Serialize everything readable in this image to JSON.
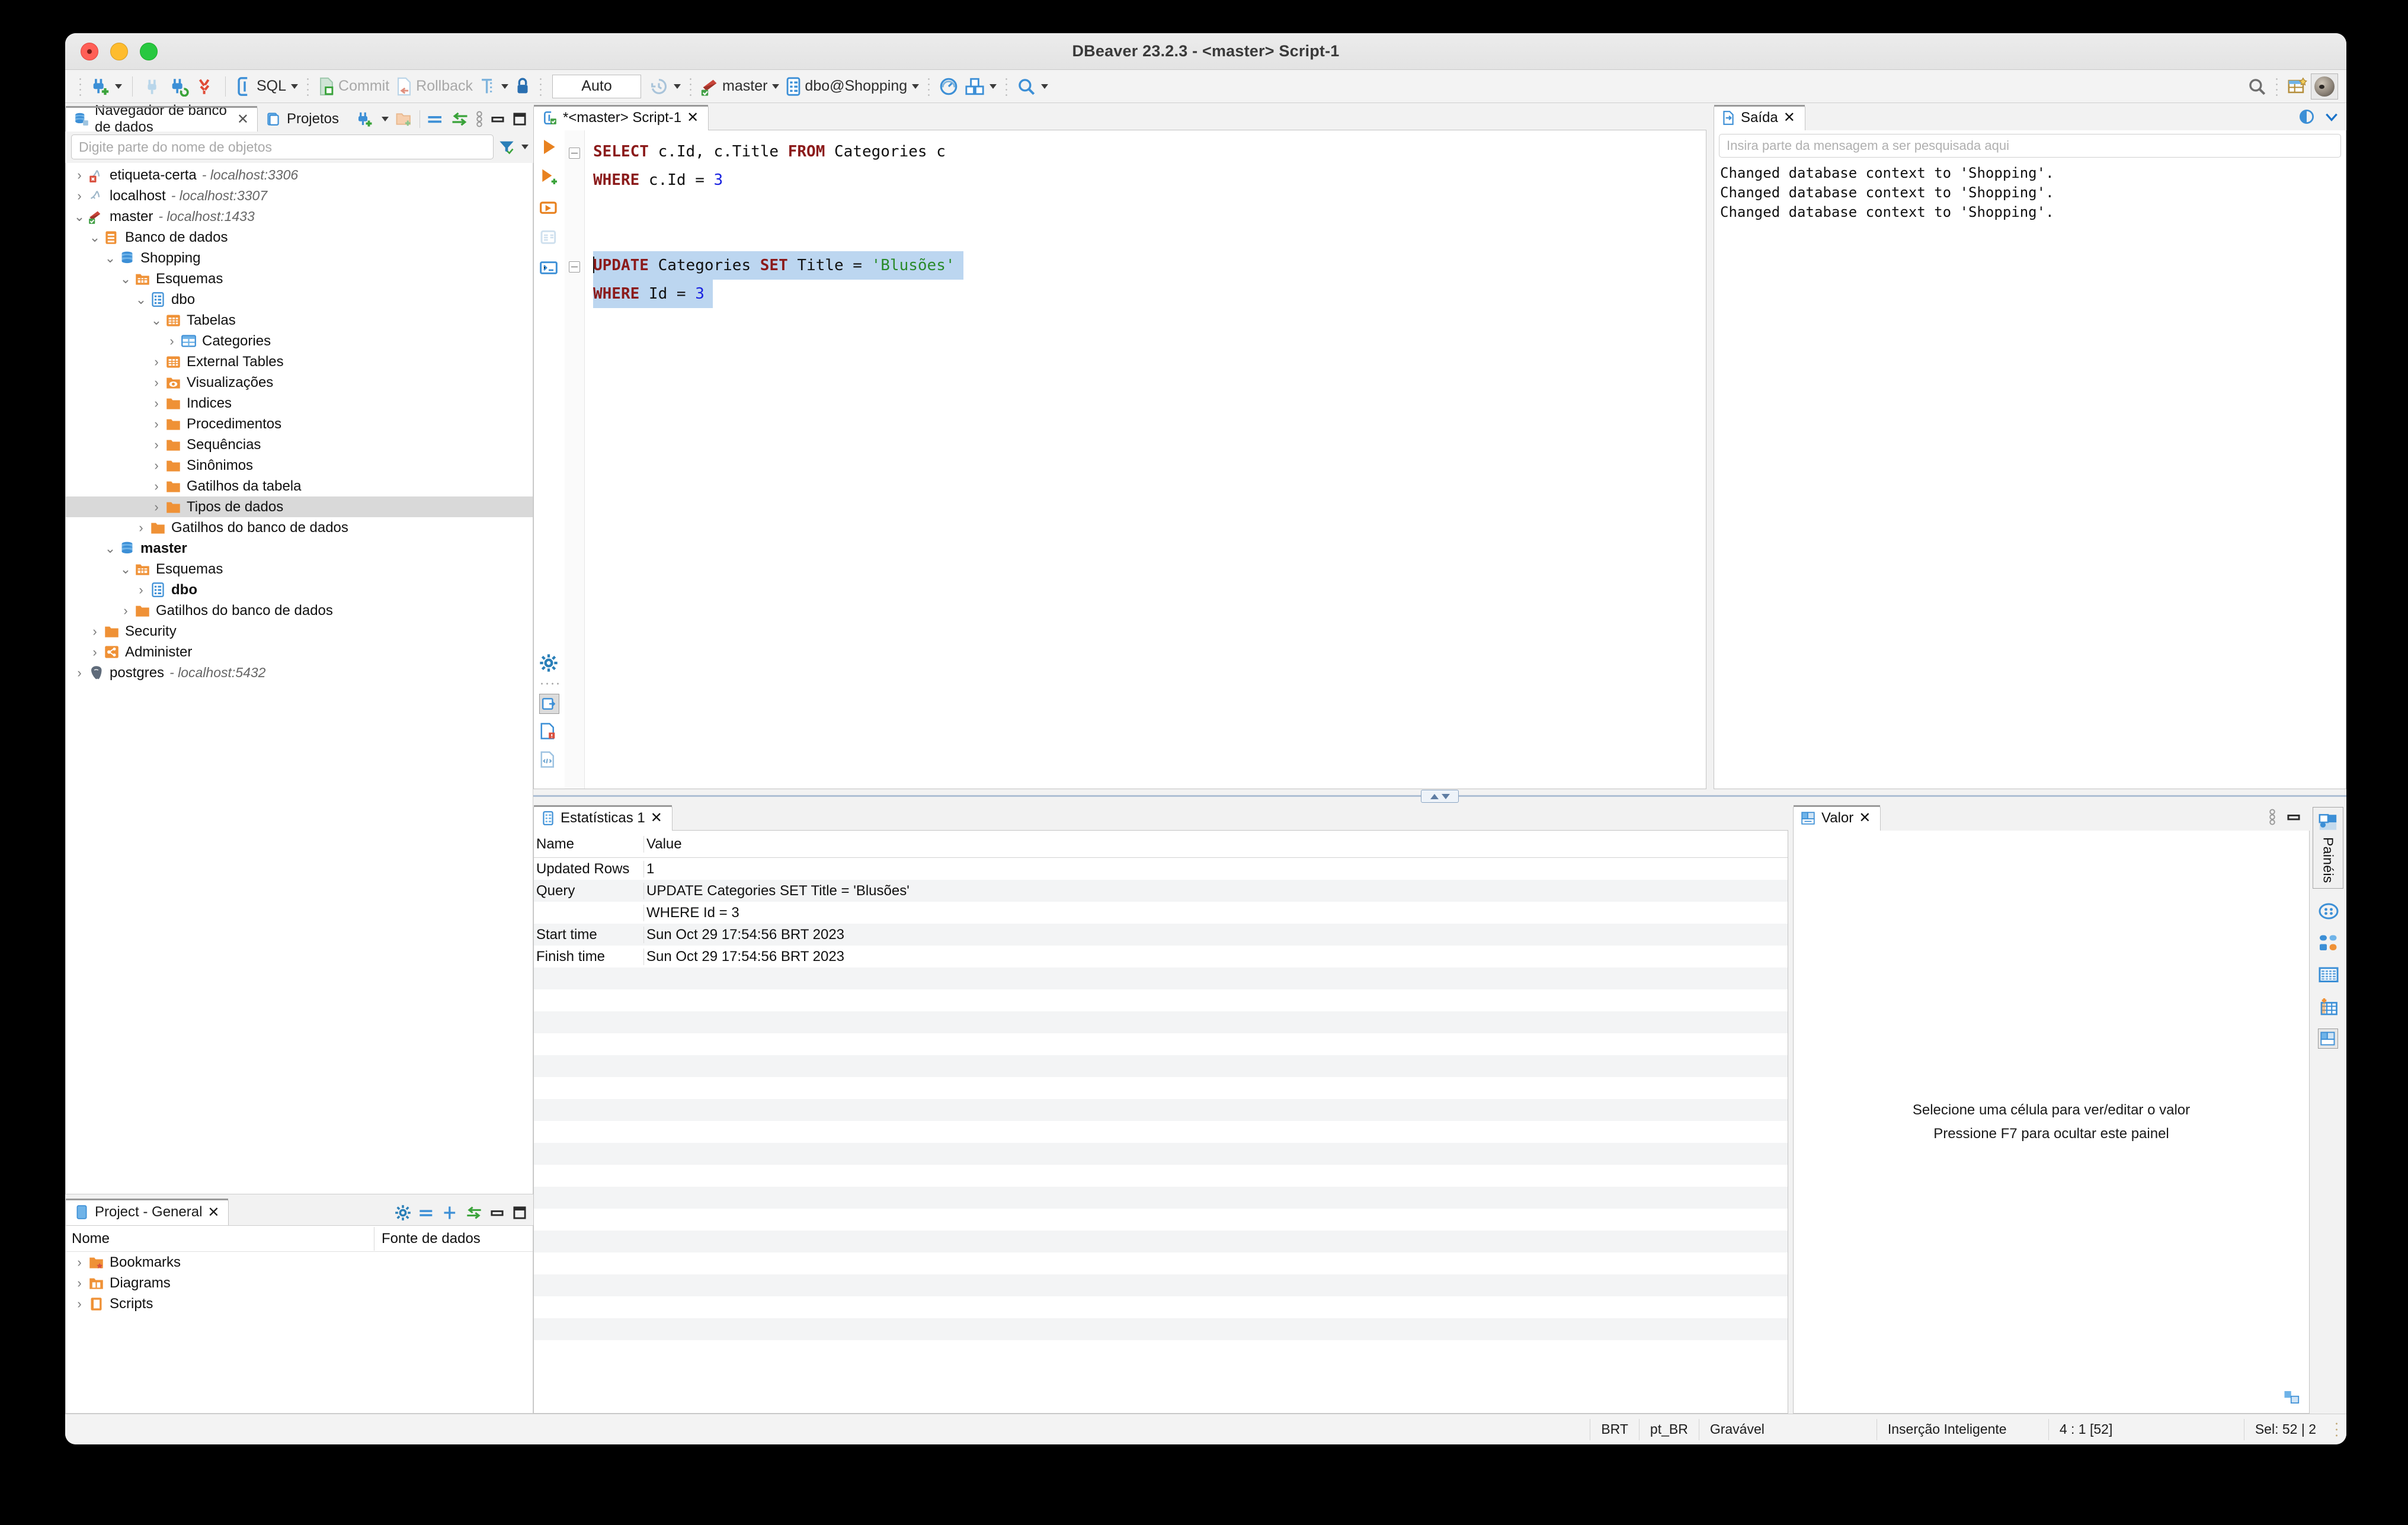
{
  "window": {
    "title": "DBeaver 23.2.3 - <master> Script-1"
  },
  "toolbar": {
    "sql_label": "SQL",
    "commit_label": "Commit",
    "rollback_label": "Rollback",
    "auto_label": "Auto",
    "connection_label": "master",
    "schema_label": "dbo@Shopping",
    "icons": {
      "new_connection": "new-connection-icon",
      "disconnect": "disconnect-icon",
      "refresh_connection": "refresh-connection-icon",
      "disconnect_all": "disconnect-all-icon",
      "sql_editor": "sql-editor-icon",
      "commit": "commit-icon",
      "rollback": "rollback-icon",
      "transaction_mode": "transaction-mode-icon",
      "lock": "lock-icon",
      "history": "history-icon",
      "server": "server-icon",
      "dashboard": "dashboard-icon",
      "packages": "packages-icon",
      "search": "search-icon",
      "search_right": "search-icon",
      "new_window": "new-window-icon",
      "avatar": "avatar"
    }
  },
  "navigator": {
    "tabs": [
      {
        "label": "Navegador de banco de dados",
        "icon": "database-navigator-icon",
        "active": true,
        "closable": true
      },
      {
        "label": "Projetos",
        "icon": "projects-icon",
        "active": false,
        "closable": false
      }
    ],
    "filter_placeholder": "Digite parte do nome de objetos",
    "tree": [
      {
        "depth": 0,
        "label": "etiqueta-certa",
        "sub": "- localhost:3306",
        "arrow": "right",
        "icon": "mysql-error-icon"
      },
      {
        "depth": 0,
        "label": "localhost",
        "sub": "- localhost:3307",
        "arrow": "right",
        "icon": "mysql-icon"
      },
      {
        "depth": 0,
        "label": "master",
        "sub": "- localhost:1433",
        "arrow": "down",
        "icon": "mssql-connected-icon"
      },
      {
        "depth": 1,
        "label": "Banco de dados",
        "sub": "",
        "arrow": "down",
        "icon": "databases-folder-icon"
      },
      {
        "depth": 2,
        "label": "Shopping",
        "sub": "",
        "arrow": "down",
        "icon": "database-icon"
      },
      {
        "depth": 3,
        "label": "Esquemas",
        "sub": "",
        "arrow": "down",
        "icon": "schemas-folder-icon"
      },
      {
        "depth": 4,
        "label": "dbo",
        "sub": "",
        "arrow": "down",
        "icon": "schema-icon"
      },
      {
        "depth": 5,
        "label": "Tabelas",
        "sub": "",
        "arrow": "down",
        "icon": "tables-folder-icon"
      },
      {
        "depth": 6,
        "label": "Categories",
        "sub": "",
        "arrow": "right",
        "icon": "table-icon"
      },
      {
        "depth": 5,
        "label": "External Tables",
        "sub": "",
        "arrow": "right",
        "icon": "tables-folder-icon"
      },
      {
        "depth": 5,
        "label": "Visualizações",
        "sub": "",
        "arrow": "right",
        "icon": "views-folder-icon"
      },
      {
        "depth": 5,
        "label": "Indices",
        "sub": "",
        "arrow": "right",
        "icon": "folder-icon"
      },
      {
        "depth": 5,
        "label": "Procedimentos",
        "sub": "",
        "arrow": "right",
        "icon": "folder-icon"
      },
      {
        "depth": 5,
        "label": "Sequências",
        "sub": "",
        "arrow": "right",
        "icon": "folder-icon"
      },
      {
        "depth": 5,
        "label": "Sinônimos",
        "sub": "",
        "arrow": "right",
        "icon": "folder-icon"
      },
      {
        "depth": 5,
        "label": "Gatilhos da tabela",
        "sub": "",
        "arrow": "right",
        "icon": "folder-icon"
      },
      {
        "depth": 5,
        "label": "Tipos de dados",
        "sub": "",
        "arrow": "right",
        "icon": "folder-icon",
        "selected": true
      },
      {
        "depth": 4,
        "label": "Gatilhos do banco de dados",
        "sub": "",
        "arrow": "right",
        "icon": "folder-icon"
      },
      {
        "depth": 2,
        "label": "master",
        "sub": "",
        "arrow": "down",
        "icon": "database-icon",
        "bold": true
      },
      {
        "depth": 3,
        "label": "Esquemas",
        "sub": "",
        "arrow": "down",
        "icon": "schemas-folder-icon"
      },
      {
        "depth": 4,
        "label": "dbo",
        "sub": "",
        "arrow": "right",
        "icon": "schema-icon",
        "bold": true
      },
      {
        "depth": 3,
        "label": "Gatilhos do banco de dados",
        "sub": "",
        "arrow": "right",
        "icon": "folder-icon"
      },
      {
        "depth": 1,
        "label": "Security",
        "sub": "",
        "arrow": "right",
        "icon": "folder-icon"
      },
      {
        "depth": 1,
        "label": "Administer",
        "sub": "",
        "arrow": "right",
        "icon": "administer-icon"
      },
      {
        "depth": 0,
        "label": "postgres",
        "sub": "- localhost:5432",
        "arrow": "right",
        "icon": "postgres-icon"
      }
    ]
  },
  "project_panel": {
    "tab_label": "Project - General",
    "columns": [
      "Nome",
      "Fonte de dados"
    ],
    "rows": [
      {
        "label": "Bookmarks",
        "icon": "bookmarks-folder-icon",
        "datasource": ""
      },
      {
        "label": "Diagrams",
        "icon": "diagrams-folder-icon",
        "datasource": ""
      },
      {
        "label": "Scripts",
        "icon": "scripts-folder-icon",
        "datasource": ""
      }
    ]
  },
  "editor": {
    "tab_label": "*<master> Script-1",
    "lines": [
      {
        "segments": [
          {
            "t": "SELECT",
            "c": "kw"
          },
          {
            "t": " c.Id, c.Title ",
            "c": ""
          },
          {
            "t": "FROM",
            "c": "kw"
          },
          {
            "t": " Categories c",
            "c": ""
          }
        ],
        "fold": true,
        "selected": false
      },
      {
        "segments": [
          {
            "t": "WHERE",
            "c": "kw"
          },
          {
            "t": " c.Id = ",
            "c": ""
          },
          {
            "t": "3",
            "c": "num"
          }
        ],
        "fold": false,
        "selected": false
      },
      {
        "segments": [],
        "fold": false,
        "selected": false
      },
      {
        "segments": [],
        "fold": false,
        "selected": false
      },
      {
        "segments": [
          {
            "t": "UPDATE",
            "c": "kw"
          },
          {
            "t": " Categories ",
            "c": ""
          },
          {
            "t": "SET",
            "c": "kw"
          },
          {
            "t": " Title = ",
            "c": ""
          },
          {
            "t": "'Blusões'",
            "c": "str"
          }
        ],
        "fold": true,
        "selected": true,
        "caret": true
      },
      {
        "segments": [
          {
            "t": "WHERE",
            "c": "kw"
          },
          {
            "t": " Id = ",
            "c": ""
          },
          {
            "t": "3",
            "c": "num"
          }
        ],
        "fold": false,
        "selected": true
      }
    ]
  },
  "output_panel": {
    "tab_label": "Saída",
    "search_placeholder": "Insira parte da mensagem a ser pesquisada aqui",
    "lines": [
      "Changed database context to 'Shopping'.",
      "Changed database context to 'Shopping'.",
      "Changed database context to 'Shopping'."
    ]
  },
  "statistics_panel": {
    "tab_label": "Estatísticas 1",
    "columns": [
      "Name",
      "Value"
    ],
    "rows": [
      {
        "name": "Updated Rows",
        "value": "1"
      },
      {
        "name": "Query",
        "value": "UPDATE Categories SET Title = 'Blusões'"
      },
      {
        "name": "",
        "value": "WHERE Id = 3"
      },
      {
        "name": "Start time",
        "value": "Sun Oct 29 17:54:56 BRT 2023"
      },
      {
        "name": "Finish time",
        "value": "Sun Oct 29 17:54:56 BRT 2023"
      }
    ],
    "empty_row_count": 17
  },
  "value_panel": {
    "tab_label": "Valor",
    "message_line1": "Selecione uma célula para ver/editar o valor",
    "message_line2": "Pressione F7 para ocultar este painel"
  },
  "panels_sidebar": {
    "label": "Painéis",
    "buttons": [
      {
        "name": "panels-toggle",
        "icon": "panels-icon",
        "active": true
      },
      {
        "name": "grid-config",
        "icon": "grid-config-icon",
        "active": false
      },
      {
        "name": "record-mode",
        "icon": "record-mode-icon",
        "active": false
      },
      {
        "name": "grid-view",
        "icon": "grid-view-icon",
        "active": false
      },
      {
        "name": "calc-panel",
        "icon": "calc-panel-icon",
        "active": false
      },
      {
        "name": "value-panel",
        "icon": "value-panel-icon",
        "active": true
      }
    ]
  },
  "statusbar": {
    "timezone": "BRT",
    "locale": "pt_BR",
    "writable": "Gravável",
    "insert_mode": "Inserção Inteligente",
    "position": "4 : 1 [52]",
    "selection": "Sel: 52 | 2"
  },
  "colors": {
    "accent_blue": "#3c8fd6",
    "orange": "#ef9136",
    "keyword_red": "#8b1a1a",
    "string_green": "#2a8a2a",
    "number_blue": "#1a23e0",
    "selection_blue": "#bcd6f0"
  }
}
